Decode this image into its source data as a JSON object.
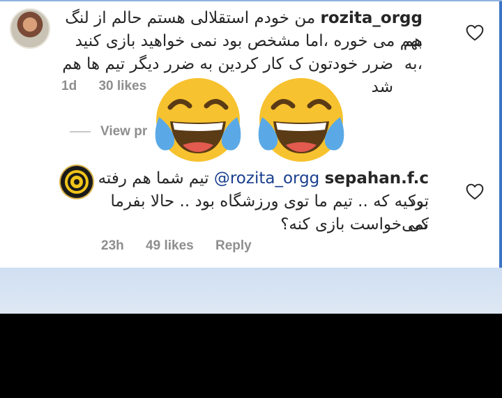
{
  "comments": [
    {
      "username": "rozita_orgg",
      "line1": "من خودم استقلالی هستم حالم از لنگ هم",
      "line2": "بهم می خوره ،اما مشخص بود نمی خواهید بازی کنید ،به",
      "line3": "ضرر خودتون ک کار کردین به ضرر دیگر تیم ها هم شد",
      "time": "1d",
      "likes": "30 likes",
      "view_replies": "View pr                  es (",
      "avatar": "profile-photo"
    },
    {
      "username": "sepahan.f.c",
      "mention": "@rozita_orgg",
      "line1": "تیم شما هم رفته بود",
      "line2": "ترکیه که .. تیم ما توی ورزشگاه بود .. حالا بفرما کی",
      "line3": "نمی‌خواست بازی کنه؟",
      "time": "23h",
      "likes": "49 likes",
      "reply": "Reply",
      "avatar": "club-crest"
    }
  ],
  "overlay": {
    "emojis": [
      "face-with-tears-of-joy",
      "face-with-tears-of-joy"
    ]
  },
  "colors": {
    "text": "#262626",
    "meta": "#8e8e8e",
    "mention": "#1a3f8f",
    "frame": "#3b74c6",
    "emoji_face": "#f7c22f"
  },
  "icons": [
    "heart-outline-icon",
    "face-with-tears-of-joy"
  ]
}
